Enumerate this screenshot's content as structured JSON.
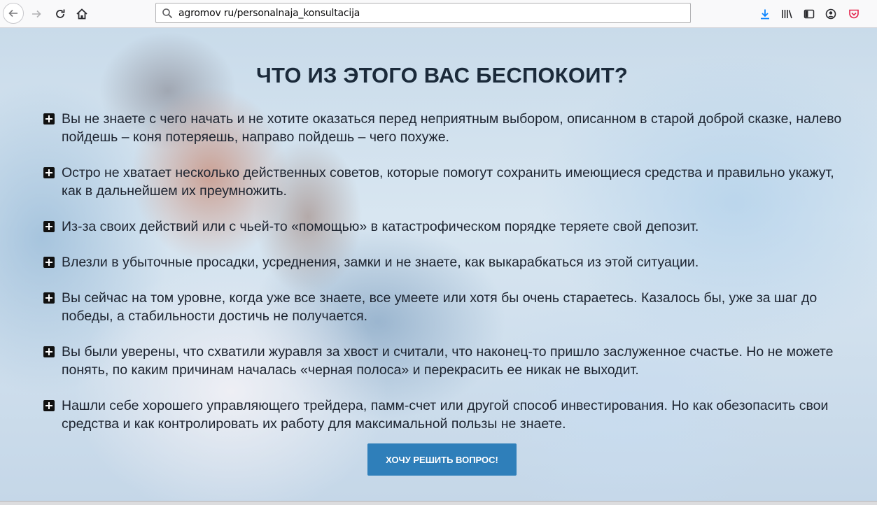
{
  "browser": {
    "url": "agromov ru/personalnaja_konsultacija",
    "icons": [
      "back-arrow-icon",
      "forward-arrow-icon",
      "reload-icon",
      "home-icon",
      "search-icon",
      "download-icon",
      "library-icon",
      "sidebar-icon",
      "account-icon",
      "pocket-icon"
    ],
    "accent_color": "#0a84ff"
  },
  "page": {
    "title": "ЧТО ИЗ ЭТОГО ВАС БЕСПОКОИТ?",
    "concerns": [
      "Вы не знаете с чего начать и не хотите оказаться перед неприятным выбором, описанном в старой доброй сказке, налево пойдешь – коня потеряешь, направо пойдешь – чего похуже.",
      "Остро не хватает несколько действенных советов, которые помогут сохранить имеющиеся средства и правильно укажут, как в дальнейшем их преумножить.",
      "Из-за своих действий или с чьей-то «помощью» в катастрофическом порядке теряете свой депозит.",
      "Влезли в убыточные просадки, усреднения, замки и не знаете, как выкарабкаться из этой ситуации.",
      "Вы сейчас на том уровне, когда уже все знаете, все умеете или хотя бы очень стараетесь. Казалось бы, уже за шаг до победы, а стабильности достичь не получается.",
      "Вы были уверены, что схватили журавля за хвост и считали, что наконец-то пришло заслуженное счастье. Но не можете понять, по каким причинам началась «черная полоса» и перекрасить ее никак не выходит.",
      "Нашли себе хорошего управляющего трейдера, памм-счет или другой способ инвестирования. Но как обезопасить свои средства и как контролировать их работу для максимальной пользы не знаете."
    ],
    "cta_label": "ХОЧУ РЕШИТЬ ВОПРОС!",
    "cta_color": "#2f7fba"
  }
}
